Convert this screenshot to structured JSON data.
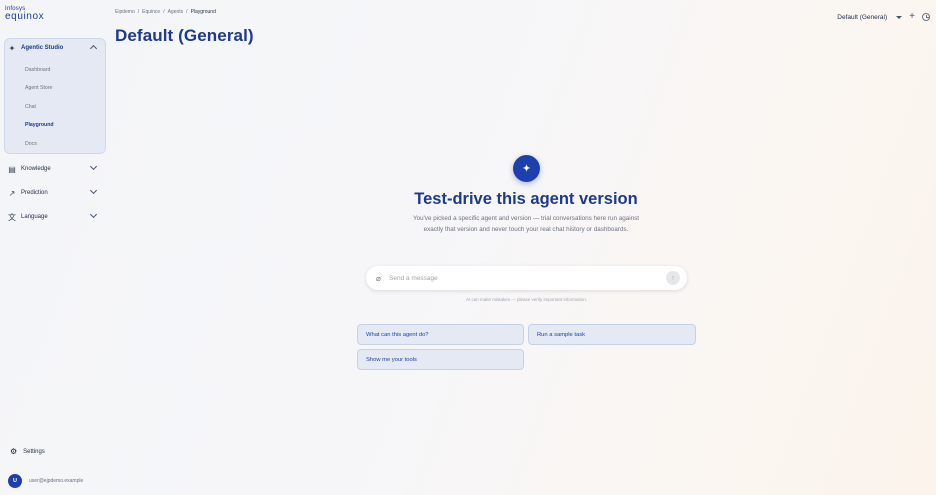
{
  "logo": {
    "line1": "Infosys",
    "line2": "equinox"
  },
  "sidebar": {
    "agentic_studio": {
      "label": "Agentic Studio",
      "items": [
        {
          "label": "Dashboard"
        },
        {
          "label": "Agent Store"
        },
        {
          "label": "Chat"
        },
        {
          "label": "Playground",
          "active": true
        },
        {
          "label": "Docs"
        }
      ]
    },
    "sections": [
      {
        "label": "Knowledge",
        "icon": "book-icon"
      },
      {
        "label": "Prediction",
        "icon": "trend-icon"
      },
      {
        "label": "Language",
        "icon": "translate-icon"
      }
    ],
    "settings_label": "Settings",
    "user": {
      "initial": "U",
      "email": "user@ejpdemo.example"
    }
  },
  "breadcrumb": [
    "Eipdemo",
    "/",
    "Equince",
    "/",
    "Agents",
    "/",
    "Playground"
  ],
  "page_title": "Default (General)",
  "header": {
    "agent_select": "Default (General)"
  },
  "hero": {
    "title": "Test-drive this agent version",
    "description": "You've picked a specific agent and version — trial conversations here run against exactly that version and never touch your real chat history or dashboards."
  },
  "composer": {
    "placeholder": "Send a message",
    "disclaimer": "AI can make mistakes — please verify important information."
  },
  "suggestions": [
    {
      "label": "What can this agent do?"
    },
    {
      "label": "Run a sample task"
    },
    {
      "label": "Show me your tools"
    }
  ],
  "colors": {
    "accent": "#1e40af",
    "title": "#1e3a8a",
    "chip_bg": "#e4e9f4"
  }
}
